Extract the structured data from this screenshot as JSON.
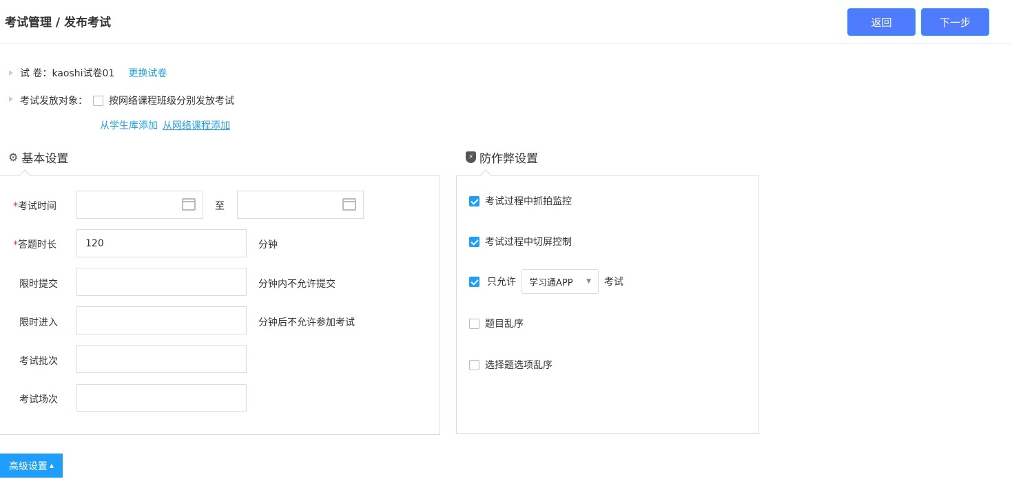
{
  "header": {
    "breadcrumb": "考试管理 / 发布考试",
    "back_label": "返回",
    "next_label": "下一步"
  },
  "paper": {
    "label": "试 卷：",
    "name": "kaoshi试卷01",
    "change_link": "更换试卷"
  },
  "target": {
    "label": "考试发放对象：",
    "checkbox_label": "按网络课程班级分别发放考试",
    "checked": false,
    "add_from_students": "从学生库添加",
    "add_from_course": "从网络课程添加"
  },
  "basic": {
    "title": "基本设置",
    "exam_time": {
      "label": "考试时间",
      "to": "至",
      "start": "",
      "end": ""
    },
    "duration": {
      "label": "答题时长",
      "value": "120",
      "unit": "分钟"
    },
    "limit_submit": {
      "label": "限时提交",
      "value": "",
      "unit": "分钟内不允许提交"
    },
    "limit_enter": {
      "label": "限时进入",
      "value": "",
      "unit": "分钟后不允许参加考试"
    },
    "batch": {
      "label": "考试批次",
      "value": ""
    },
    "session": {
      "label": "考试场次",
      "value": ""
    }
  },
  "anticheat": {
    "title": "防作弊设置",
    "snapshot": {
      "label": "考试过程中抓拍监控",
      "checked": true
    },
    "switch_screen": {
      "label": "考试过程中切屏控制",
      "checked": true
    },
    "only_allow": {
      "label": "只允许",
      "select": "学习通APP",
      "suffix": "考试",
      "checked": true
    },
    "shuffle_questions": {
      "label": "题目乱序",
      "checked": false
    },
    "shuffle_options": {
      "label": "选择题选项乱序",
      "checked": false
    }
  },
  "advanced": {
    "label": "高级设置"
  }
}
